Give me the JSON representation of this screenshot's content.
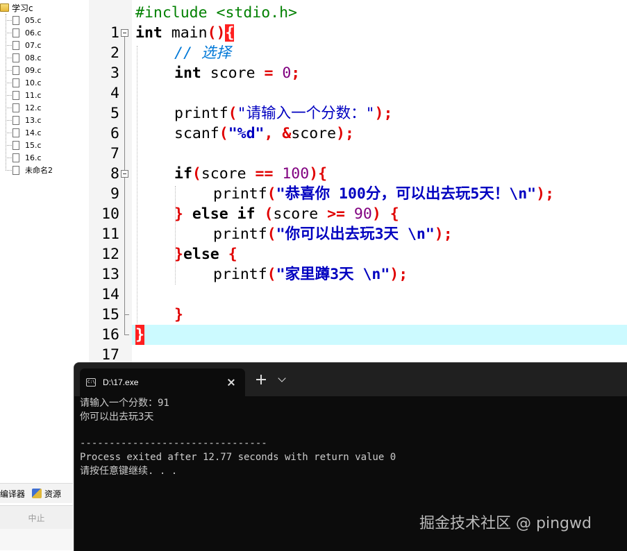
{
  "project_tree": {
    "root": "学习c",
    "files": [
      "05.c",
      "06.c",
      "07.c",
      "08.c",
      "09.c",
      "10.c",
      "11.c",
      "12.c",
      "13.c",
      "14.c",
      "15.c",
      "16.c",
      "未命名2"
    ]
  },
  "left_panel": {
    "tab_compiler": "编译器",
    "tab_resources": "资源",
    "status_button": "中止"
  },
  "editor": {
    "line_numbers": [
      "1",
      "2",
      "3",
      "4",
      "5",
      "6",
      "7",
      "8",
      "9",
      "10",
      "11",
      "12",
      "13",
      "14",
      "15",
      "16",
      "17"
    ],
    "code": {
      "l1": "#include <stdio.h>",
      "l2_kw": "int",
      "l2_fn": " main",
      "l2_paren": "()",
      "l2_brace": "{",
      "l3_comment": "// 选择",
      "l4_kw": "int",
      "l4_var": " score ",
      "l4_op": "=",
      "l4_num": " 0",
      "l4_semi": ";",
      "l6_fn": "printf",
      "l6_str": "\"请输入一个分数：\"",
      "l7_fn": "scanf",
      "l7_str": "\"%d\"",
      "l7_comma": ", ",
      "l7_amp": "&",
      "l7_var": "score",
      "l9_kw": "if",
      "l9_var": "score ",
      "l9_op": "==",
      "l9_num": " 100",
      "l10_fn": "printf",
      "l10_str": "\"恭喜你 100分，可以出去玩5天！\\n\"",
      "l11_else": "else if",
      "l11_var": "score ",
      "l11_op": ">=",
      "l11_num": " 90",
      "l12_fn": "printf",
      "l12_str": "\"你可以出去玩3天 \\n\"",
      "l13_else": "else",
      "l14_fn": "printf",
      "l14_str": "\"家里蹲3天 \\n\"",
      "l17_brace": "}"
    }
  },
  "console": {
    "tab_title": "D:\\17.exe",
    "lines": [
      "请输入一个分数：91",
      "你可以出去玩3天",
      "",
      "--------------------------------",
      "Process exited after 12.77 seconds with return value 0",
      "请按任意键继续. . ."
    ]
  },
  "watermark": "掘金技术社区 @ pingwd",
  "colors": {
    "current_line": "#ccfaff",
    "keyword": "#000000",
    "operator": "#e00000",
    "number": "#800080",
    "string": "#0000c0",
    "comment": "#0078d7",
    "preprocessor": "#008000",
    "console_bg": "#0c0c0c"
  }
}
